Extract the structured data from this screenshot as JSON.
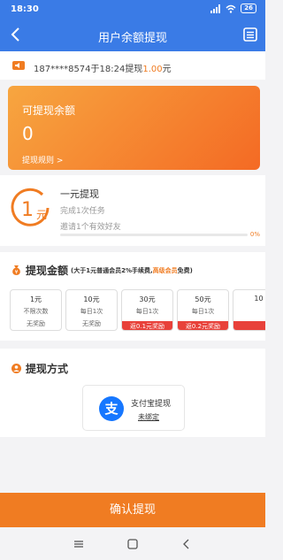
{
  "status_bar": {
    "time": "18:30",
    "battery": "26"
  },
  "nav": {
    "title": "用户余额提现"
  },
  "notice": {
    "text": "187****8574于18:24提现",
    "amount": "1.00",
    "unit": "元"
  },
  "balance": {
    "label": "可提现余额",
    "value": "0",
    "rule_link": "提现规则 >"
  },
  "one_yuan": {
    "badge_num": "1",
    "badge_unit": "元",
    "title": "一元提现",
    "task": "完成1次任务",
    "invite": "邀请1个有效好友",
    "progress": 0,
    "progress_label": "0%"
  },
  "amount_section": {
    "title": "提现金额",
    "note_prefix": "(大于1元普通会员2%手续费,",
    "note_highlight": "高级会员",
    "note_suffix": "免费)",
    "options": [
      {
        "amount": "1元",
        "limit": "不限次数",
        "reward": "无奖励"
      },
      {
        "amount": "10元",
        "limit": "每日1次",
        "reward": "无奖励"
      },
      {
        "amount": "30元",
        "limit": "每日1次",
        "reward": "返0.1元奖励"
      },
      {
        "amount": "50元",
        "limit": "每日1次",
        "reward": "返0.2元奖励"
      },
      {
        "amount": "10",
        "limit": "",
        "reward": ""
      }
    ]
  },
  "method_section": {
    "title": "提现方式",
    "alipay": {
      "logo": "支",
      "name": "支付宝提现",
      "status": "未绑定"
    }
  },
  "confirm": {
    "label": "确认提现"
  },
  "colors": {
    "primary": "#3a7be6",
    "accent": "#f07c22",
    "reward_red": "#e8413a",
    "alipay": "#1677ff"
  }
}
